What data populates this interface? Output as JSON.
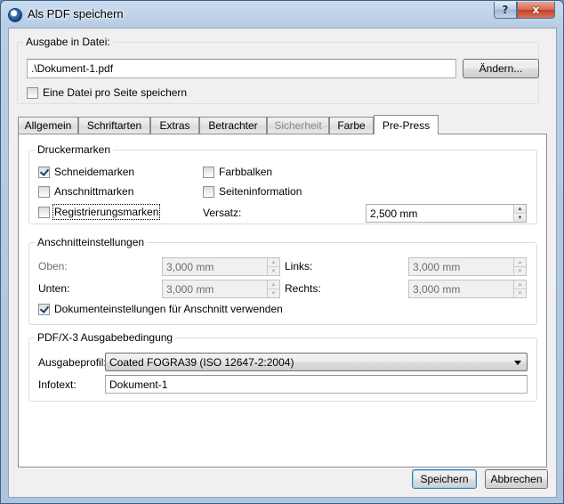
{
  "window": {
    "title": "Als PDF speichern"
  },
  "titlebar": {
    "help_label": "?",
    "close_label": "x"
  },
  "output": {
    "group_title": "Ausgabe in Datei:",
    "file_value": ".\\Dokument-1.pdf",
    "change_label": "Ändern...",
    "per_page_label": "Eine Datei pro Seite speichern",
    "per_page_checked": false
  },
  "tabs": [
    {
      "label": "Allgemein",
      "state": "normal"
    },
    {
      "label": "Schriftarten",
      "state": "normal"
    },
    {
      "label": "Extras",
      "state": "normal"
    },
    {
      "label": "Betrachter",
      "state": "normal"
    },
    {
      "label": "Sicherheit",
      "state": "disabled"
    },
    {
      "label": "Farbe",
      "state": "normal"
    },
    {
      "label": "Pre-Press",
      "state": "active"
    }
  ],
  "printer_marks": {
    "group_title": "Druckermarken",
    "crop_marks": {
      "label": "Schneidemarken",
      "checked": true
    },
    "bleed_marks": {
      "label": "Anschnittmarken",
      "checked": false
    },
    "registration_marks": {
      "label": "Registrierungsmarken",
      "checked": false
    },
    "color_bars": {
      "label": "Farbbalken",
      "checked": false
    },
    "page_info": {
      "label": "Seiteninformation",
      "checked": false
    },
    "offset_label": "Versatz:",
    "offset_value": "2,500 mm"
  },
  "bleed": {
    "group_title": "Anschnitteinstellungen",
    "top_label": "Oben:",
    "top_value": "3,000 mm",
    "bottom_label": "Unten:",
    "bottom_value": "3,000 mm",
    "left_label": "Links:",
    "left_value": "3,000 mm",
    "right_label": "Rechts:",
    "right_value": "3,000 mm",
    "use_doc_label": "Dokumenteinstellungen für Anschnitt verwenden",
    "use_doc_checked": true
  },
  "pdfx": {
    "group_title": "PDF/X-3 Ausgabebedingung",
    "profile_label": "Ausgabeprofil:",
    "profile_value": "Coated FOGRA39 (ISO 12647-2:2004)",
    "info_label": "Infotext:",
    "info_value": "Dokument-1"
  },
  "footer": {
    "save_label": "Speichern",
    "cancel_label": "Abbrechen"
  }
}
